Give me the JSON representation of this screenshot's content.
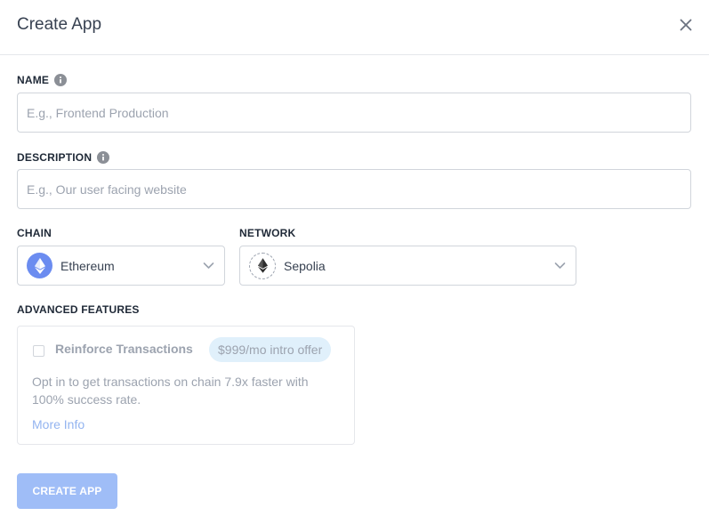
{
  "header": {
    "title": "Create App",
    "close_icon": "close-icon"
  },
  "form": {
    "name": {
      "label": "NAME",
      "placeholder": "E.g., Frontend Production",
      "value": "",
      "icon": "info-icon"
    },
    "description": {
      "label": "DESCRIPTION",
      "placeholder": "E.g., Our user facing website",
      "value": "",
      "icon": "info-icon"
    },
    "chain": {
      "label": "CHAIN",
      "selected": "Ethereum",
      "icon": "ethereum-icon"
    },
    "network": {
      "label": "NETWORK",
      "selected": "Sepolia",
      "icon": "ethereum-icon"
    }
  },
  "advanced": {
    "label": "ADVANCED FEATURES",
    "feature": {
      "title": "Reinforce Transactions",
      "badge": "$999/mo intro offer",
      "description": "Opt in to get transactions on chain 7.9x faster with 100% success rate.",
      "link": "More Info",
      "checked": false
    }
  },
  "actions": {
    "create_label": "CREATE APP"
  },
  "colors": {
    "primary_disabled": "#9fbdf7",
    "badge_bg": "#e0f0fb",
    "chain_logo": "#6b8cf0",
    "link": "#93b4f0"
  }
}
